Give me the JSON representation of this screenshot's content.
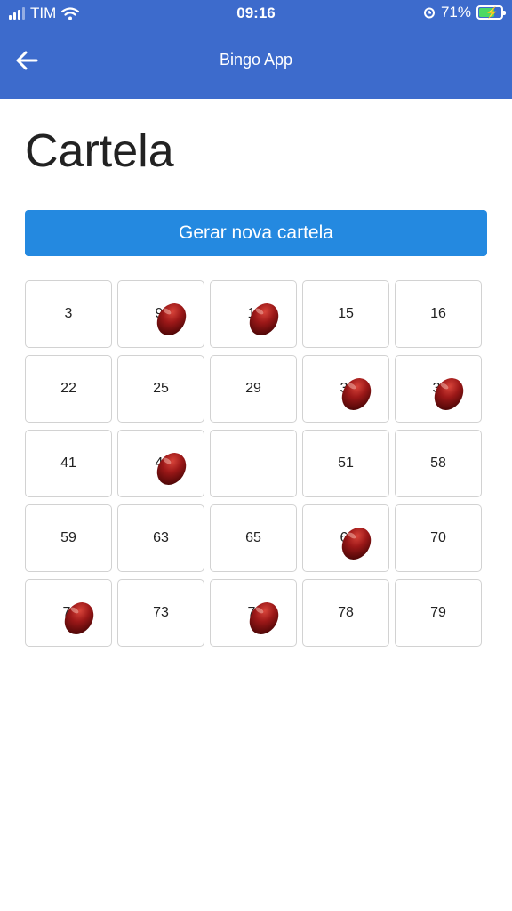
{
  "status_bar": {
    "carrier": "TIM",
    "time": "09:16",
    "battery": "71%",
    "battery_level": 0.71
  },
  "toolbar": {
    "title": "Bingo App"
  },
  "page": {
    "title": "Cartela",
    "generate_button": "Gerar nova cartela"
  },
  "card": [
    [
      {
        "number": "3",
        "marked": false
      },
      {
        "number": "9",
        "marked": true
      },
      {
        "number": "1",
        "marked": true
      },
      {
        "number": "15",
        "marked": false
      },
      {
        "number": "16",
        "marked": false
      }
    ],
    [
      {
        "number": "22",
        "marked": false
      },
      {
        "number": "25",
        "marked": false
      },
      {
        "number": "29",
        "marked": false
      },
      {
        "number": "3",
        "marked": true
      },
      {
        "number": "3",
        "marked": true
      }
    ],
    [
      {
        "number": "41",
        "marked": false
      },
      {
        "number": "4",
        "marked": true
      },
      {
        "number": "",
        "marked": false
      },
      {
        "number": "51",
        "marked": false
      },
      {
        "number": "58",
        "marked": false
      }
    ],
    [
      {
        "number": "59",
        "marked": false
      },
      {
        "number": "63",
        "marked": false
      },
      {
        "number": "65",
        "marked": false
      },
      {
        "number": "6",
        "marked": true
      },
      {
        "number": "70",
        "marked": false
      }
    ],
    [
      {
        "number": "7",
        "marked": true
      },
      {
        "number": "73",
        "marked": false
      },
      {
        "number": "7",
        "marked": true
      },
      {
        "number": "78",
        "marked": false
      },
      {
        "number": "79",
        "marked": false
      }
    ]
  ],
  "colors": {
    "header": "#3d6bcc",
    "button": "#2489e0",
    "bean": "#8e1414"
  }
}
